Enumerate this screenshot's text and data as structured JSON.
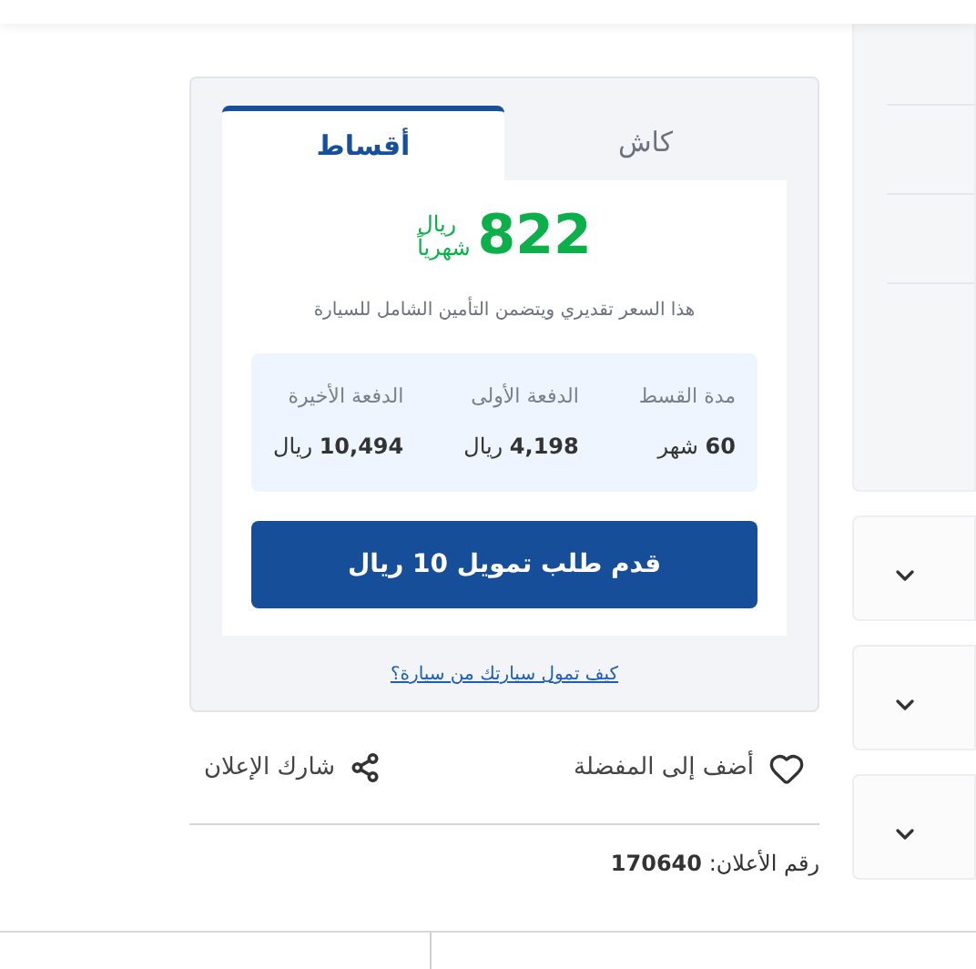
{
  "tabs": [
    {
      "label": "كاش",
      "selected": false
    },
    {
      "label": "أقساط",
      "selected": true
    }
  ],
  "price": {
    "amount": "822",
    "unit": "ريال",
    "period": "شهرياً"
  },
  "note": "هذا السعر تقديري ويتضمن التأمين الشامل للسيارة",
  "installment": [
    {
      "label": "مدة القسط",
      "value": "**60** شهر"
    },
    {
      "label": "الدفعة الأولى",
      "value": "**4,198** ريال"
    },
    {
      "label": "الدفعة الأخيرة",
      "value": "**10,494** ريال"
    }
  ],
  "apply_button": "قدم طلب تمويل 10 ريال",
  "finance_link": "كيف تمول سيارتك من سيارة؟",
  "actions": [
    {
      "kind": "favorite",
      "label": "أضف إلى المفضلة"
    },
    {
      "kind": "share",
      "label": "شارك الإعلان"
    }
  ],
  "ad_number": "رقم الأعلان: **170640**",
  "accordions": [
    {
      "expanded": false
    },
    {
      "expanded": false
    },
    {
      "expanded": false
    }
  ]
}
